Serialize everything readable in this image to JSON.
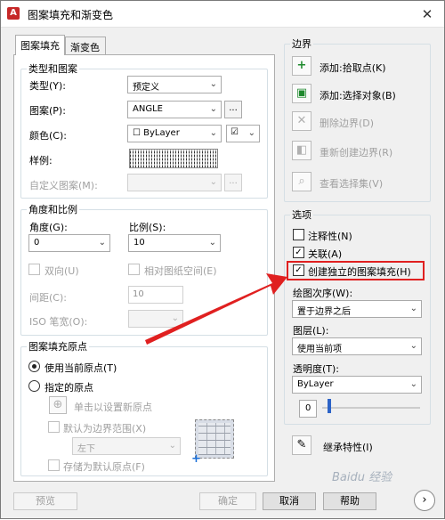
{
  "window": {
    "title": "图案填充和渐变色",
    "app_icon": "A",
    "close": "✕"
  },
  "tabs": [
    {
      "label": "图案填充"
    },
    {
      "label": "渐变色"
    }
  ],
  "type_pattern": {
    "legend": "类型和图案",
    "type_label": "类型(Y):",
    "type_value": "预定义",
    "pattern_label": "图案(P):",
    "pattern_value": "ANGLE",
    "pattern_more": "...",
    "color_label": "颜色(C):",
    "color_value": "ByLayer",
    "color_box_glyph": "☐",
    "bg_glyph": "☑",
    "sample_label": "样例:",
    "custom_label": "自定义图案(M):",
    "custom_more": "..."
  },
  "angle_scale": {
    "legend": "角度和比例",
    "angle_label": "角度(G):",
    "angle_value": "0",
    "scale_label": "比例(S):",
    "scale_value": "10",
    "double_label": "双向(U)",
    "relative_label": "相对图纸空间(E)",
    "spacing_label": "间距(C):",
    "spacing_value": "10",
    "iso_label": "ISO 笔宽(O):"
  },
  "origin": {
    "legend": "图案填充原点",
    "use_current": "使用当前原点(T)",
    "specified": "指定的原点",
    "click_set": "单击以设置新原点",
    "default_boundary": "默认为边界范围(X)",
    "position_value": "左下",
    "store_default": "存储为默认原点(F)",
    "origin_glyph": "+"
  },
  "boundary": {
    "legend": "边界",
    "add_pick": "添加:拾取点(K)",
    "add_select": "添加:选择对象(B)",
    "remove": "删除边界(D)",
    "recreate": "重新创建边界(R)",
    "view_selection": "查看选择集(V)"
  },
  "options": {
    "legend": "选项",
    "annotative": "注释性(N)",
    "associative": "关联(A)",
    "separate": "创建独立的图案填充(H)",
    "draw_order_label": "绘图次序(W):",
    "draw_order_value": "置于边界之后",
    "layer_label": "图层(L):",
    "layer_value": "使用当前项",
    "transparency_label": "透明度(T):",
    "transparency_value": "ByLayer",
    "transparency_number": "0",
    "inherit": "继承特性(I)"
  },
  "buttons": {
    "preview": "预览",
    "ok": "确定",
    "cancel": "取消",
    "help": "帮助",
    "more": "›"
  },
  "watermark": "Baidu 经验",
  "icons": {
    "chevron": "⌄",
    "check": "✓",
    "add_pick": "+",
    "add_select": "▣",
    "remove": "✕",
    "recreate": "◧",
    "view": "⌕",
    "inherit": "✎",
    "click_set": "⊕"
  },
  "colors": {
    "highlight": "#e02020",
    "arrow": "#e02020",
    "thumb": "#2c63c7"
  }
}
